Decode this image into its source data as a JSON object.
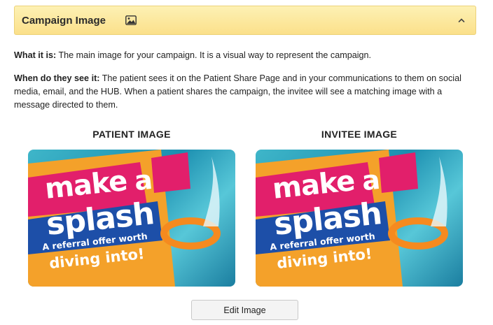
{
  "panel": {
    "title": "Campaign Image",
    "image_icon": "image-icon",
    "toggle_icon": "chevron-up-icon",
    "expanded": true,
    "accent_color": "#fbe08a"
  },
  "what_it_is": {
    "label": "What it is:",
    "text": " The main image for your campaign. It is a visual way to represent the campaign."
  },
  "when_seen": {
    "label": "When do they see it:",
    "text": " The patient sees it on the Patient Share Page and in your communications to them on social media, email, and the HUB. When a patient shares the campaign, the invitee will see a matching image with a message directed to them."
  },
  "images": [
    {
      "heading": "PATIENT IMAGE",
      "line1": "make",
      "line1b": "a",
      "line2": "splash",
      "tagline": "A referral offer worth",
      "tagline2": "diving into!"
    },
    {
      "heading": "INVITEE IMAGE",
      "line1": "make",
      "line1b": "a",
      "line2": "splash",
      "tagline": "A referral offer worth",
      "tagline2": "diving into!"
    }
  ],
  "edit_button": {
    "label": "Edit Image"
  }
}
